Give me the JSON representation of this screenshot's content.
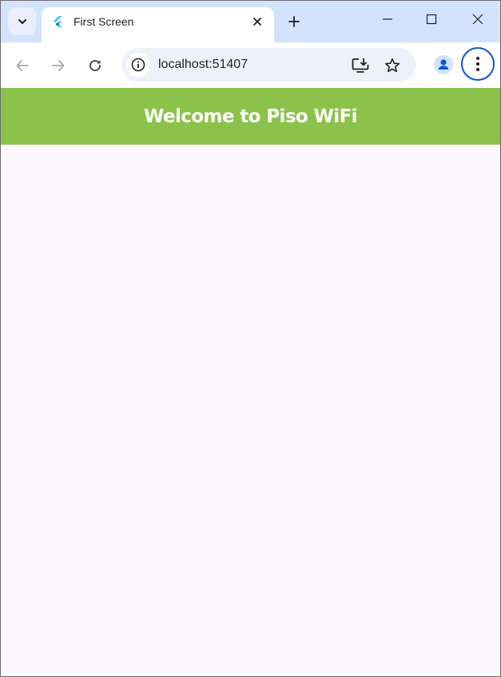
{
  "browser": {
    "tab": {
      "title": "First Screen",
      "favicon": "flutter-icon"
    },
    "address_bar": {
      "url": "localhost:51407"
    },
    "colors": {
      "tabstrip": "#d3e3fd",
      "accent": "#0b57d0"
    }
  },
  "app": {
    "appbar": {
      "title": "Welcome to Piso WiFi",
      "color": "#8bc34a"
    },
    "background": "#fcf6fd"
  }
}
